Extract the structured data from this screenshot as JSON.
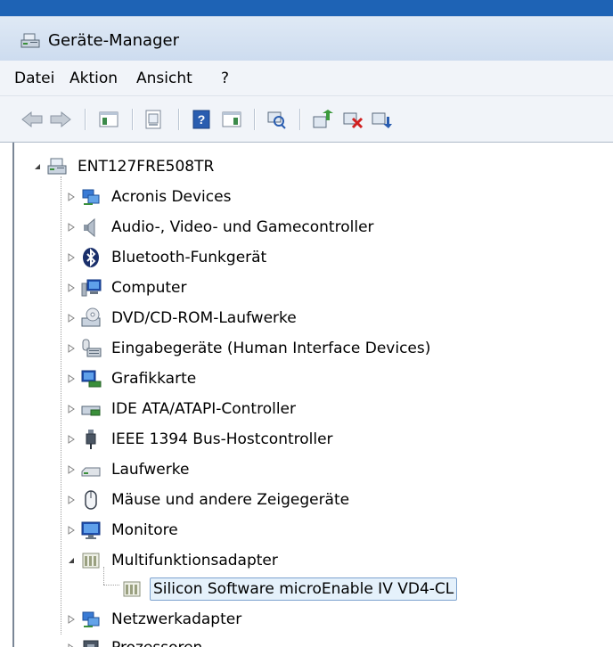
{
  "window": {
    "title": "Geräte-Manager"
  },
  "menu": {
    "items": [
      "Datei",
      "Aktion",
      "Ansicht",
      "?"
    ]
  },
  "toolbar": {
    "buttons": [
      "back-icon",
      "forward-icon",
      "show-hide-console-tree-icon",
      "properties-icon",
      "help-icon",
      "show-action-pane-icon",
      "scan-hardware-icon",
      "update-driver-icon",
      "disable-device-icon",
      "uninstall-device-icon"
    ]
  },
  "tree": {
    "root": "ENT127FRE508TR",
    "categories": [
      {
        "label": "Acronis Devices",
        "icon": "network-device-icon"
      },
      {
        "label": "Audio-, Video- und Gamecontroller",
        "icon": "speaker-icon"
      },
      {
        "label": "Bluetooth-Funkgerät",
        "icon": "bluetooth-icon"
      },
      {
        "label": "Computer",
        "icon": "computer-icon"
      },
      {
        "label": "DVD/CD-ROM-Laufwerke",
        "icon": "dvd-drive-icon"
      },
      {
        "label": "Eingabegeräte (Human Interface Devices)",
        "icon": "keyboard-icon"
      },
      {
        "label": "Grafikkarte",
        "icon": "display-adapter-icon"
      },
      {
        "label": "IDE ATA/ATAPI-Controller",
        "icon": "ide-controller-icon"
      },
      {
        "label": "IEEE 1394 Bus-Hostcontroller",
        "icon": "firewire-icon"
      },
      {
        "label": "Laufwerke",
        "icon": "disk-drive-icon"
      },
      {
        "label": "Mäuse und andere Zeigegeräte",
        "icon": "mouse-icon"
      },
      {
        "label": "Monitore",
        "icon": "monitor-icon"
      },
      {
        "label": "Multifunktionsadapter",
        "icon": "multifunction-adapter-icon"
      },
      {
        "label": "Silicon Software microEnable IV VD4-CL",
        "icon": "multifunction-adapter-icon"
      },
      {
        "label": "Netzwerkadapter",
        "icon": "network-adapter-icon"
      },
      {
        "label": "Prozessoren",
        "icon": "processor-icon"
      }
    ]
  }
}
